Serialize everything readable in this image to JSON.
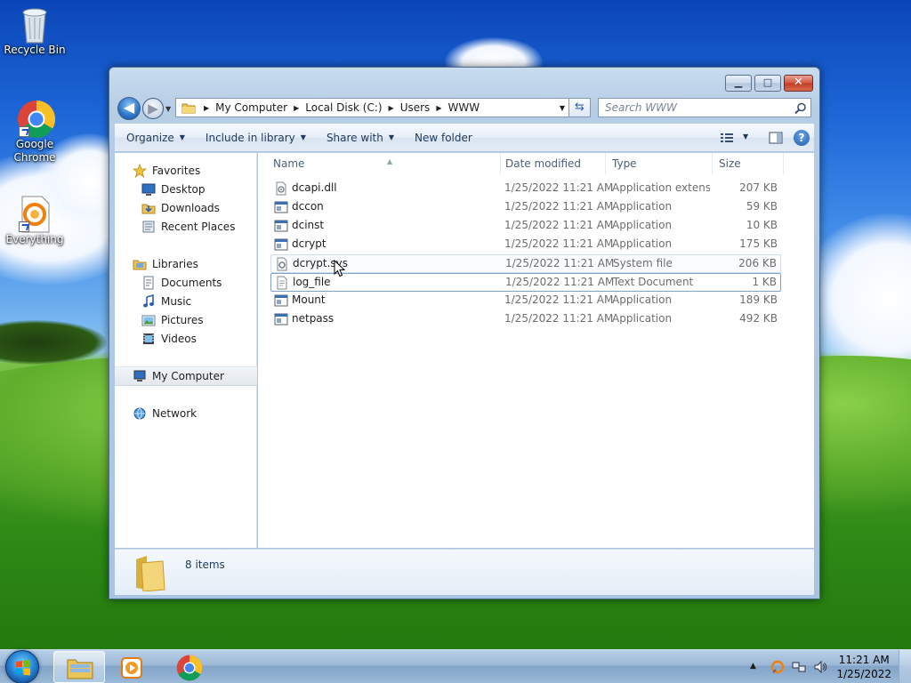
{
  "desktop": {
    "icons": [
      {
        "label": "Recycle Bin",
        "icon": "recycle-bin-icon"
      },
      {
        "label": "Google Chrome",
        "icon": "chrome-icon"
      },
      {
        "label": "Everything",
        "icon": "everything-icon"
      }
    ]
  },
  "window": {
    "controls": {
      "minimize": "▁",
      "maximize": "□",
      "close": "✕"
    },
    "address": {
      "breadcrumbs": [
        "My Computer",
        "Local Disk (C:)",
        "Users",
        "WWW"
      ]
    },
    "search": {
      "placeholder": "Search WWW"
    },
    "toolbar": {
      "organize": "Organize",
      "include_in_library": "Include in library",
      "share_with": "Share with",
      "new_folder": "New folder"
    },
    "navpane": {
      "favorites": {
        "label": "Favorites",
        "items": [
          "Desktop",
          "Downloads",
          "Recent Places"
        ]
      },
      "libraries": {
        "label": "Libraries",
        "items": [
          "Documents",
          "Music",
          "Pictures",
          "Videos"
        ]
      },
      "computer": {
        "label": "My Computer"
      },
      "network": {
        "label": "Network"
      }
    },
    "columns": {
      "name": "Name",
      "date": "Date modified",
      "type": "Type",
      "size": "Size"
    },
    "files": [
      {
        "name": "dcapi.dll",
        "date": "1/25/2022 11:21 AM",
        "type": "Application extens...",
        "size": "207 KB",
        "icon": "dll-file-icon"
      },
      {
        "name": "dccon",
        "date": "1/25/2022 11:21 AM",
        "type": "Application",
        "size": "59 KB",
        "icon": "application-icon"
      },
      {
        "name": "dcinst",
        "date": "1/25/2022 11:21 AM",
        "type": "Application",
        "size": "10 KB",
        "icon": "application-icon"
      },
      {
        "name": "dcrypt",
        "date": "1/25/2022 11:21 AM",
        "type": "Application",
        "size": "175 KB",
        "icon": "application-icon"
      },
      {
        "name": "dcrypt.sys",
        "date": "1/25/2022 11:21 AM",
        "type": "System file",
        "size": "206 KB",
        "icon": "system-file-icon"
      },
      {
        "name": "log_file",
        "date": "1/25/2022 11:21 AM",
        "type": "Text Document",
        "size": "1 KB",
        "icon": "text-file-icon"
      },
      {
        "name": "Mount",
        "date": "1/25/2022 11:21 AM",
        "type": "Application",
        "size": "189 KB",
        "icon": "application-icon"
      },
      {
        "name": "netpass",
        "date": "1/25/2022 11:21 AM",
        "type": "Application",
        "size": "492 KB",
        "icon": "application-icon"
      }
    ],
    "status": {
      "item_count": "8 items"
    }
  },
  "taskbar": {
    "clock_time": "11:21 AM",
    "clock_date": "1/25/2022"
  },
  "colors": {
    "accent": "#1e395b",
    "selection_border": "#7da2ce",
    "hover_border": "#d0dcec"
  }
}
